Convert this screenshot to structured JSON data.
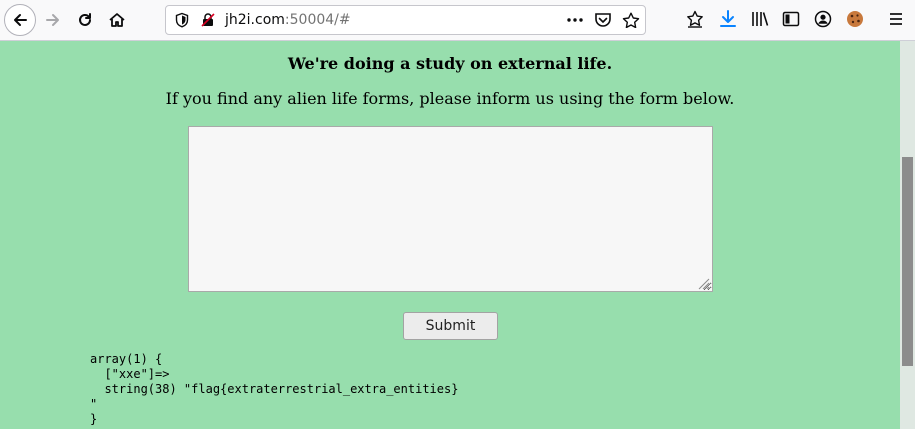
{
  "browser": {
    "url_host": "jh2i.com",
    "url_rest": ":50004/#",
    "icons": [
      "back-arrow-icon",
      "forward-arrow-icon",
      "reload-icon",
      "home-icon",
      "shield-icon",
      "insecure-lock-icon",
      "more-dots-icon",
      "pocket-icon",
      "star-icon",
      "bookmark-icon",
      "download-icon",
      "library-icon",
      "sidebar-icon",
      "account-icon",
      "cookie-icon",
      "menu-icon"
    ]
  },
  "page": {
    "heading": "We're doing a study on external life.",
    "intro": "If you find any alien life forms, please inform us using the form below.",
    "report_value": "",
    "submit_label": "Submit",
    "dump": [
      "array(1) {",
      "  [\"xxe\"]=>",
      "  string(38) \"flag{extraterrestrial_extra_entities}",
      "\"",
      "}"
    ]
  }
}
